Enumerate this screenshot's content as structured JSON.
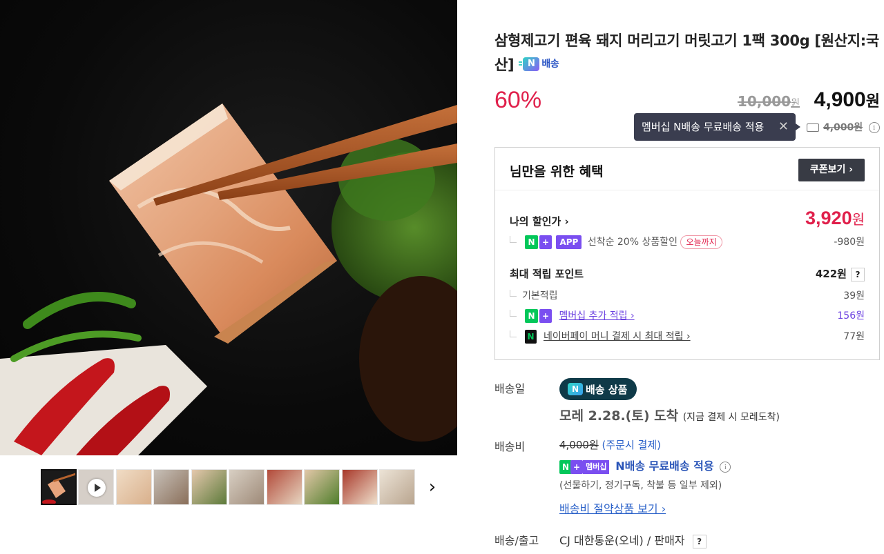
{
  "product": {
    "title": "삼형제고기 편육 돼지 머리고기 머릿고기 1팩 300g [원산지:국산]",
    "badge_n": "N",
    "badge_text": "배송"
  },
  "price": {
    "discount": "60%",
    "original": "10,000",
    "original_unit": "원",
    "sale": "4,900",
    "sale_unit": "원"
  },
  "tooltip": {
    "text": "멤버십 N배송 무료배송 적용",
    "close": "✕"
  },
  "shipping_strike": {
    "fee": "4,000원"
  },
  "benefit": {
    "title": "님만을 위한 혜택",
    "coupon_button": "쿠폰보기 ›",
    "my_price_label": "나의 할인가 ›",
    "my_price": "3,920",
    "my_price_unit": "원",
    "app_discount_text": "선착순 20% 상품할인",
    "today_chip": "오늘까지",
    "app_discount_value": "-980원",
    "points_label": "최대 적립 포인트",
    "points_value": "422원",
    "basic_label": "기본적립",
    "basic_value": "39원",
    "membership_label": "멤버십 추가 적립 ›",
    "membership_value": "156원",
    "npay_label": "네이버페이 머니 결제 시 최대 적립 ›",
    "npay_value": "77원",
    "chip_n": "N",
    "chip_plus": "+",
    "chip_app": "APP",
    "question": "?"
  },
  "delivery": {
    "date_label": "배송일",
    "badge_n": "N",
    "badge_text": "배송 상품",
    "arrival": "모레 2.28.(토) 도착",
    "arrival_note": "(지금 결제 시 모레도착)",
    "fee_label": "배송비",
    "fee_original": "4,000원",
    "fee_note": "(주문시 결제)",
    "membership_chip": "멤버십",
    "free_text": "N배송 무료배송 적용",
    "exclusion": "(선물하기, 정기구독, 착불 등 일부 제외)",
    "save_link": "배송비 절약상품 보기 ›",
    "courier_label": "배송/출고",
    "courier_value": "CJ 대한통운(오네) / 판매자"
  },
  "thumbs": {
    "next": "›"
  },
  "colors": {
    "discount_red": "#e0204b",
    "link_blue": "#2a61c9",
    "naver_green": "#03c75a",
    "member_purple": "#7a4ef0",
    "badge_navy": "#0f3a48"
  }
}
